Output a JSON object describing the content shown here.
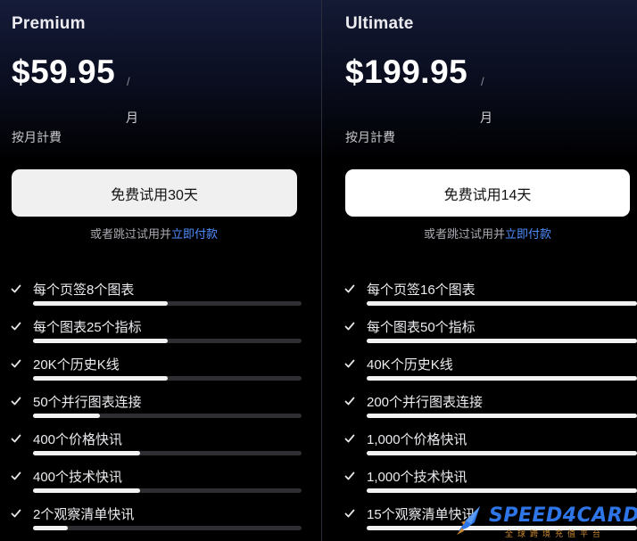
{
  "plans": [
    {
      "name": "Premium",
      "price": "$59.95",
      "slash": "/",
      "period": "月",
      "billing": "按月計費",
      "trial_button": "免费试用30天",
      "skip_text": "或者跳过试用并",
      "pay_link": "立即付款",
      "features": [
        {
          "label": "每个页签8个图表",
          "level": 0.5
        },
        {
          "label": "每个图表25个指标",
          "level": 0.5
        },
        {
          "label": "20K个历史K线",
          "level": 0.5
        },
        {
          "label": "50个并行图表连接",
          "level": 0.25
        },
        {
          "label": "400个价格快讯",
          "level": 0.4
        },
        {
          "label": "400个技术快讯",
          "level": 0.4
        },
        {
          "label": "2个观察清单快讯",
          "level": 0.13
        }
      ]
    },
    {
      "name": "Ultimate",
      "price": "$199.95",
      "slash": "/",
      "period": "月",
      "billing": "按月計費",
      "trial_button": "免费试用14天",
      "skip_text": "或者跳过试用并",
      "pay_link": "立即付款",
      "features": [
        {
          "label": "每个页签16个图表",
          "level": 1.0
        },
        {
          "label": "每个图表50个指标",
          "level": 1.0
        },
        {
          "label": "40K个历史K线",
          "level": 1.0
        },
        {
          "label": "200个并行图表连接",
          "level": 1.0
        },
        {
          "label": "1,000个价格快讯",
          "level": 1.0
        },
        {
          "label": "1,000个技术快讯",
          "level": 1.0
        },
        {
          "label": "15个观察清单快讯",
          "level": 1.0
        }
      ]
    }
  ],
  "watermark": {
    "brand": "SPEED4CARD",
    "tagline": "全球跨境充值平台"
  },
  "colors": {
    "link": "#4f8dff",
    "bar_fill": "#f2f2f2",
    "bar_track": "#2f2f33",
    "watermark_blue": "#2e76e8",
    "watermark_orange": "#c8872f"
  }
}
